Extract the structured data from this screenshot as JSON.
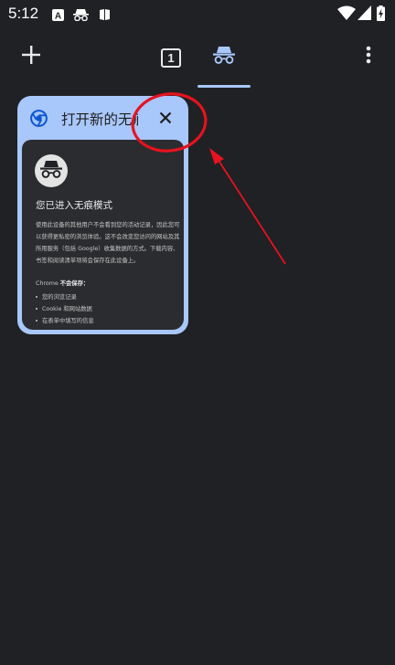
{
  "status_bar": {
    "time": "5:12",
    "icons_left": [
      "a-translate-icon",
      "incognito-icon",
      "book-icon"
    ],
    "icons_right": [
      "wifi-icon",
      "signal-icon",
      "battery-charging-icon"
    ]
  },
  "toolbar": {
    "new_tab_icon": "plus-icon",
    "tab_count": "1",
    "incognito_tab_icon": "incognito-icon",
    "menu_icon": "more-vert-icon"
  },
  "tab_card": {
    "title": "打开新的无痕式标签页",
    "favicon": "chrome-icon",
    "close_icon": "close-icon",
    "content": {
      "heading": "您已进入无痕模式",
      "paragraph": "使用此设备的其他用户不会看到您的活动记录，因此您可以获得更私密的浏览体验。这不会改变您访问的网站及其所用服务（包括 Google）收集数据的方式。下载内容、书签和阅读清单项将会保存在此设备上。",
      "not_saved_prefix": "Chrome ",
      "not_saved_bold": "不会保存：",
      "items": [
        "您的浏览记录",
        "Cookie 和网站数据",
        "在表单中填写的信息"
      ]
    }
  },
  "colors": {
    "background": "#202124",
    "card": "#a8c7fa",
    "annotation": "#e8121e"
  }
}
